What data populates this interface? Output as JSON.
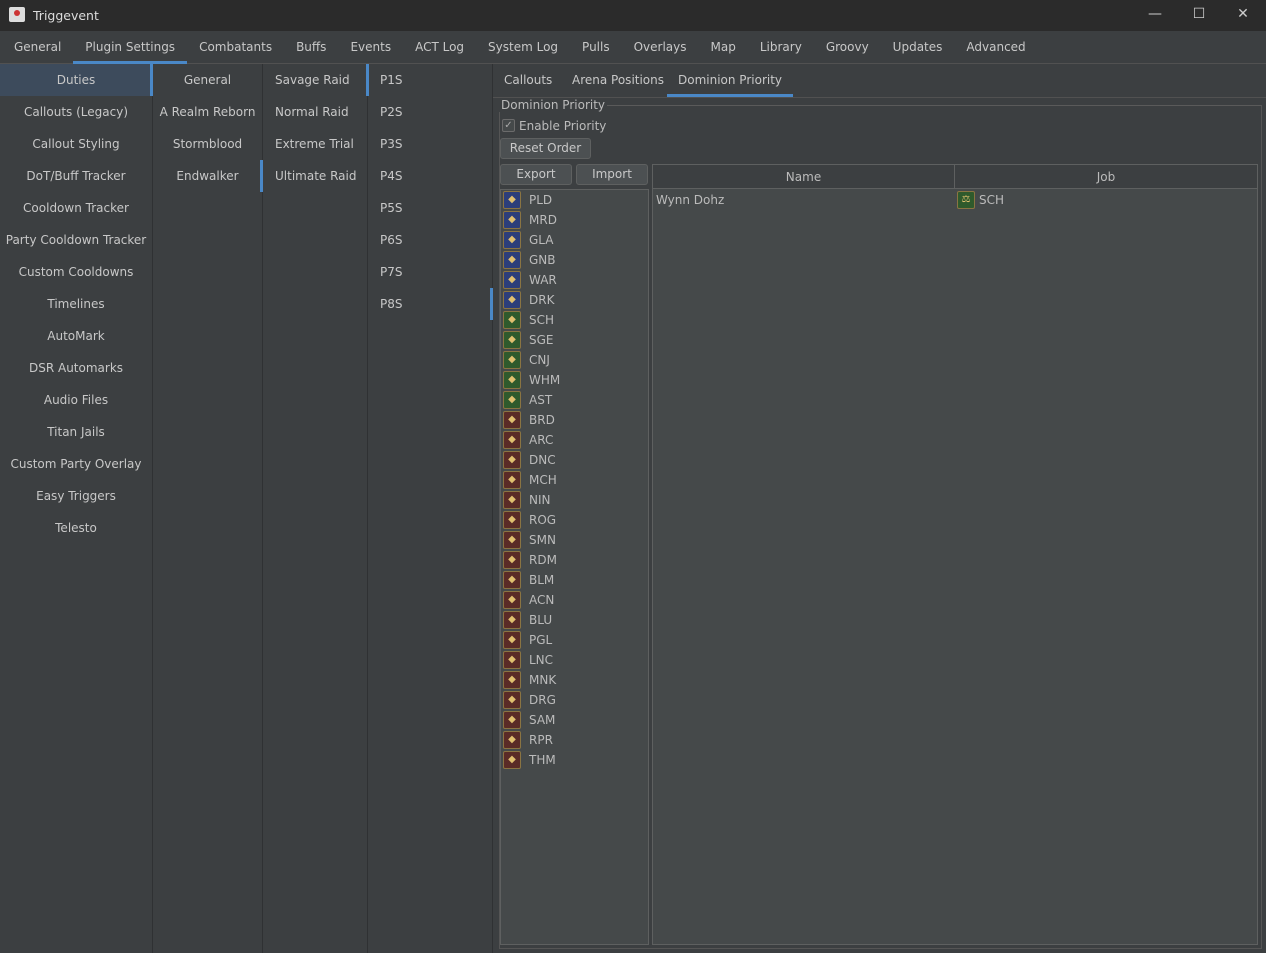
{
  "window": {
    "title": "Triggevent",
    "minimize": "—",
    "maximize": "☐",
    "close": "✕"
  },
  "main_tabs": [
    {
      "label": "General"
    },
    {
      "label": "Plugin Settings",
      "selected": true
    },
    {
      "label": "Combatants"
    },
    {
      "label": "Buffs"
    },
    {
      "label": "Events"
    },
    {
      "label": "ACT Log"
    },
    {
      "label": "System Log"
    },
    {
      "label": "Pulls"
    },
    {
      "label": "Overlays"
    },
    {
      "label": "Map"
    },
    {
      "label": "Library"
    },
    {
      "label": "Groovy"
    },
    {
      "label": "Updates"
    },
    {
      "label": "Advanced"
    }
  ],
  "col1": [
    "Duties",
    "Callouts (Legacy)",
    "Callout Styling",
    "DoT/Buff Tracker",
    "Cooldown Tracker",
    "Party Cooldown Tracker",
    "Custom Cooldowns",
    "Timelines",
    "AutoMark",
    "DSR Automarks",
    "Audio Files",
    "Titan Jails",
    "Custom Party Overlay",
    "Easy Triggers",
    "Telesto"
  ],
  "col2": [
    "General",
    "A Realm Reborn",
    "Stormblood",
    "Endwalker"
  ],
  "col3": [
    "Savage Raid",
    "Normal Raid",
    "Extreme Trial",
    "Ultimate Raid"
  ],
  "col4": [
    "P1S",
    "P2S",
    "P3S",
    "P4S",
    "P5S",
    "P6S",
    "P7S",
    "P8S"
  ],
  "sub_tabs": [
    {
      "label": "Callouts"
    },
    {
      "label": "Arena Positions"
    },
    {
      "label": "Dominion Priority",
      "selected": true
    }
  ],
  "panel": {
    "group_title": "Dominion Priority",
    "enable_label": "Enable Priority",
    "enable_checked": true,
    "reset": "Reset Order",
    "export": "Export",
    "import": "Import"
  },
  "jobs": [
    [
      "PLD",
      "tank"
    ],
    [
      "MRD",
      "tank"
    ],
    [
      "GLA",
      "tank"
    ],
    [
      "GNB",
      "tank"
    ],
    [
      "WAR",
      "tank"
    ],
    [
      "DRK",
      "tank"
    ],
    [
      "SCH",
      "healer"
    ],
    [
      "SGE",
      "healer"
    ],
    [
      "CNJ",
      "healer"
    ],
    [
      "WHM",
      "healer"
    ],
    [
      "AST",
      "healer"
    ],
    [
      "BRD",
      "dps"
    ],
    [
      "ARC",
      "dps"
    ],
    [
      "DNC",
      "dps"
    ],
    [
      "MCH",
      "dps"
    ],
    [
      "NIN",
      "dps"
    ],
    [
      "ROG",
      "dps"
    ],
    [
      "SMN",
      "dps"
    ],
    [
      "RDM",
      "dps"
    ],
    [
      "BLM",
      "dps"
    ],
    [
      "ACN",
      "dps"
    ],
    [
      "BLU",
      "dps"
    ],
    [
      "PGL",
      "dps"
    ],
    [
      "LNC",
      "dps"
    ],
    [
      "MNK",
      "dps"
    ],
    [
      "DRG",
      "dps"
    ],
    [
      "SAM",
      "dps"
    ],
    [
      "RPR",
      "dps"
    ],
    [
      "THM",
      "dps"
    ]
  ],
  "table": {
    "headers": [
      "Name",
      "Job"
    ],
    "rows": [
      {
        "name": "Wynn Dohz",
        "job": "SCH",
        "role": "healer"
      }
    ]
  },
  "colors": {
    "accent": "#4a88c7",
    "selected": "#3d4b5c",
    "tank": "#2c3e7a",
    "healer": "#2f5a2c",
    "dps": "#5a2b26"
  }
}
